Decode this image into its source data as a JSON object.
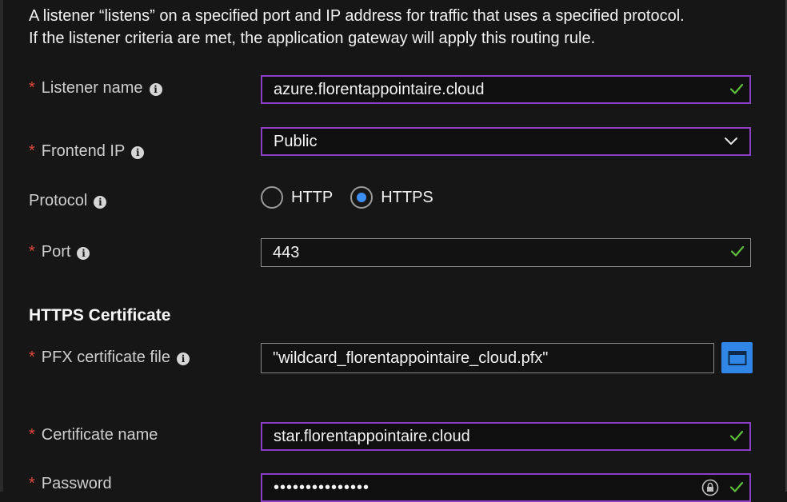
{
  "intro": {
    "line1": "A listener “listens” on a specified port and IP address for traffic that uses a specified protocol.",
    "line2": "If the listener criteria are met, the application gateway will apply this routing rule."
  },
  "listener_name": {
    "label": "Listener name",
    "value": "azure.florentappointaire.cloud"
  },
  "frontend_ip": {
    "label": "Frontend IP",
    "selected": "Public"
  },
  "protocol": {
    "label": "Protocol",
    "options": [
      {
        "label": "HTTP",
        "selected": false
      },
      {
        "label": "HTTPS",
        "selected": true
      }
    ]
  },
  "port": {
    "label": "Port",
    "value": "443"
  },
  "https_certificate": {
    "title": "HTTPS Certificate",
    "pfx_label": "PFX certificate file",
    "pfx_value": "\"wildcard_florentappointaire_cloud.pfx\"",
    "cert_name_label": "Certificate name",
    "cert_name_value": "star.florentappointaire.cloud",
    "password_label": "Password",
    "password_value": "•••••••••••••••"
  },
  "colors": {
    "background": "#161616",
    "field_border_active": "#8c3fc4",
    "required_star": "#e0473b",
    "check": "#5fbf3a",
    "radio_selected": "#3a8ff0",
    "browse_button": "#2f86e5"
  },
  "icons": {
    "info": "info-icon",
    "check": "checkmark-icon",
    "dropdown": "chevron-down-icon",
    "browse": "folder-icon",
    "lock": "lock-icon"
  }
}
